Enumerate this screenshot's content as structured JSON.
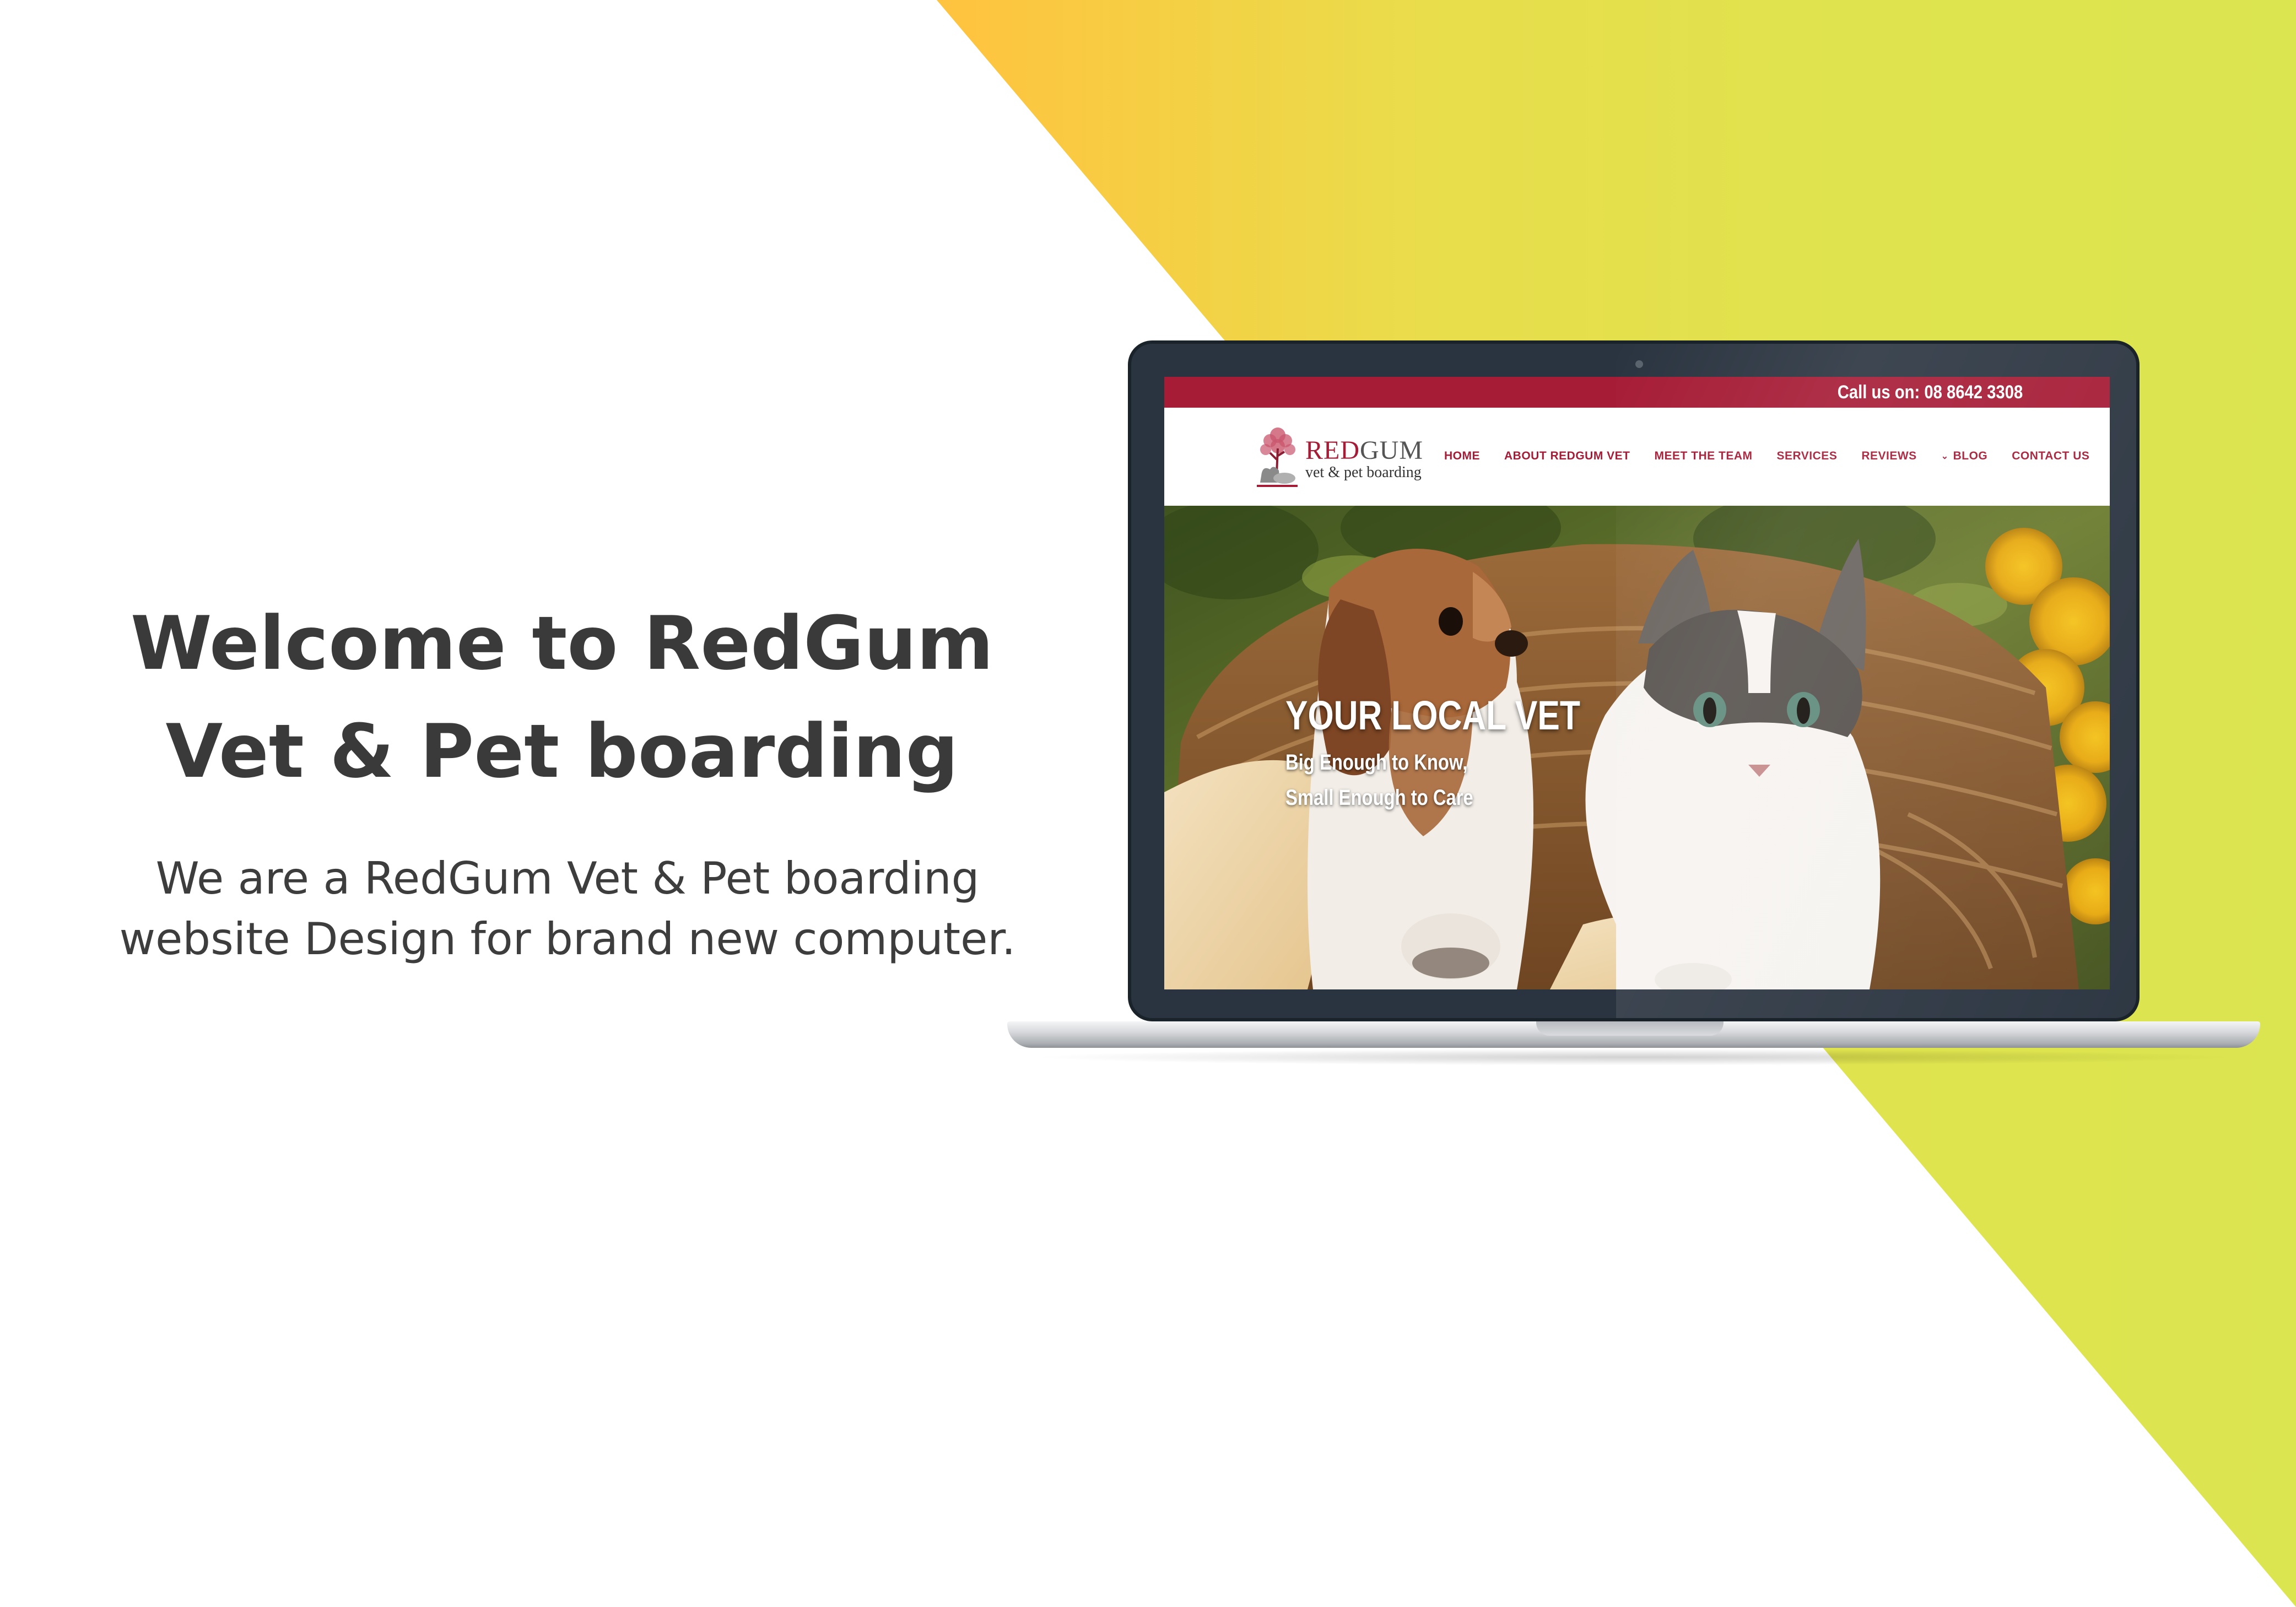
{
  "colors": {
    "brand_red": "#a61c36",
    "stripe_yellow": "#fec43f",
    "stripe_lime": "#dbe54f",
    "heading_text": "#3a3a3a"
  },
  "intro": {
    "heading_line1": "Welcome to RedGum",
    "heading_line2": "Vet & Pet boarding",
    "desc_line1": "We are a RedGum Vet & Pet boarding",
    "desc_line2": "website Design for brand new computer."
  },
  "site": {
    "topbar": {
      "call": "Call us on: 08 8642 3308"
    },
    "logo": {
      "name_red": "RED",
      "name_gray": "GUM",
      "tagline": "vet & pet boarding",
      "icon": "tree-icon"
    },
    "nav": [
      {
        "label": "HOME"
      },
      {
        "label": "ABOUT REDGUM VET"
      },
      {
        "label": "MEET THE TEAM"
      },
      {
        "label": "SERVICES"
      },
      {
        "label": "REVIEWS"
      },
      {
        "label": "BLOG",
        "icon": "chevron-down-icon"
      },
      {
        "label": "CONTACT US"
      }
    ],
    "hero": {
      "title": "YOUR LOCAL VET",
      "sub_line1": "Big Enough to Know,",
      "sub_line2": "Small Enough to Care"
    }
  }
}
